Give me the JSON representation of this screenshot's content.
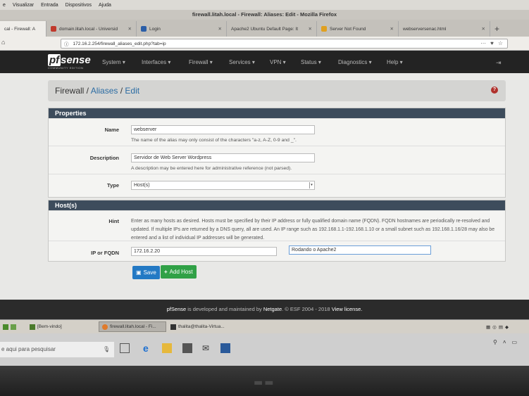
{
  "firefox": {
    "menu": [
      "e",
      "Visualizar",
      "Entrada",
      "Dispositivos",
      "Ajuda"
    ],
    "window_title": "firewall.litah.local - Firewall: Aliases: Edit - Mozilla Firefox",
    "tabs": [
      {
        "label": "cal - Firewall: A",
        "active": true
      },
      {
        "label": "domain.litah.local - Universid",
        "active": false
      },
      {
        "label": "Login",
        "active": false
      },
      {
        "label": "Apache2 Ubuntu Default Page: It",
        "active": false
      },
      {
        "label": "Server Not Found",
        "active": false
      },
      {
        "label": "webserversenac.html",
        "active": false
      }
    ],
    "url": "172.16.2.254/firewall_aliases_edit.php?tab=ip"
  },
  "pfsense": {
    "logo_text": "sense",
    "logo_prefix": "pf",
    "edition": "COMMUNITY EDITION",
    "nav": [
      "System ▾",
      "Interfaces ▾",
      "Firewall ▾",
      "Services ▾",
      "VPN ▾",
      "Status ▾",
      "Diagnostics ▾",
      "Help ▾"
    ],
    "breadcrumb": {
      "root": "Firewall",
      "sep": " / ",
      "section": "Aliases",
      "page": "Edit"
    }
  },
  "properties": {
    "heading": "Properties",
    "name_label": "Name",
    "name_value": "webserver",
    "name_help": "The name of the alias may only consist of the characters \"a-z, A-Z, 0-9 and _\".",
    "desc_label": "Description",
    "desc_value": "Servidor de Web Server Wordpress",
    "desc_help": "A description may be entered here for administrative reference (not parsed).",
    "type_label": "Type",
    "type_value": "Host(s)"
  },
  "hosts": {
    "heading": "Host(s)",
    "hint_label": "Hint",
    "hint_text": "Enter as many hosts as desired. Hosts must be specified by their IP address or fully qualified domain name (FQDN). FQDN hostnames are periodically re-resolved and updated. If multiple IPs are returned by a DNS query, all are used. An IP range such as 192.168.1.1-192.168.1.10 or a small subnet such as 192.168.1.16/28 may also be entered and a list of individual IP addresses will be generated.",
    "ip_label": "IP or FQDN",
    "ip_value": "172.16.2.20",
    "ip_desc_value": "Rodando o Apache2"
  },
  "buttons": {
    "save": "Save",
    "add_host": "Add Host"
  },
  "footer": {
    "brand": "pfSense",
    "text1": " is developed and maintained by ",
    "company": "Netgate",
    "text2": ". © ESF 2004 - 2018 ",
    "license": "View license."
  },
  "linux_taskbar": {
    "items": [
      "[Bem-vindo]",
      "firewall.litah.local - Fi...",
      "thalita@thalita-Virtua..."
    ]
  },
  "windows_taskbar": {
    "search_placeholder": "e aqui para pesquisar"
  }
}
